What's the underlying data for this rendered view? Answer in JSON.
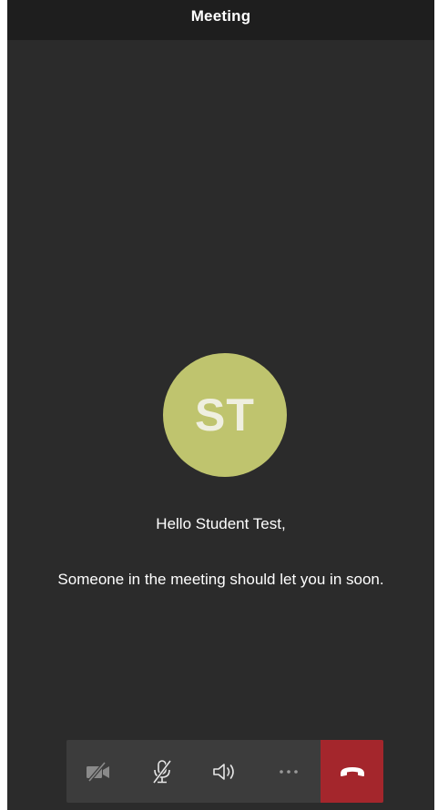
{
  "header": {
    "title": "Meeting"
  },
  "participant": {
    "initials": "ST",
    "avatar_color": "#bfc46e"
  },
  "lobby": {
    "greeting": "Hello Student Test,",
    "message": "Someone in the meeting should let you in soon."
  },
  "controls": {
    "items": [
      {
        "icon": "camera-off-icon",
        "state": "off"
      },
      {
        "icon": "microphone-muted-icon",
        "state": "muted"
      },
      {
        "icon": "speaker-icon",
        "state": "on"
      },
      {
        "icon": "more-options-icon"
      },
      {
        "icon": "hang-up-icon",
        "color": "#a4262c"
      }
    ]
  },
  "theme": {
    "background": "#2b2b2b",
    "header_background": "#1e1e1e",
    "control_bar": "#3c3c3c",
    "hang_up": "#a4262c"
  }
}
